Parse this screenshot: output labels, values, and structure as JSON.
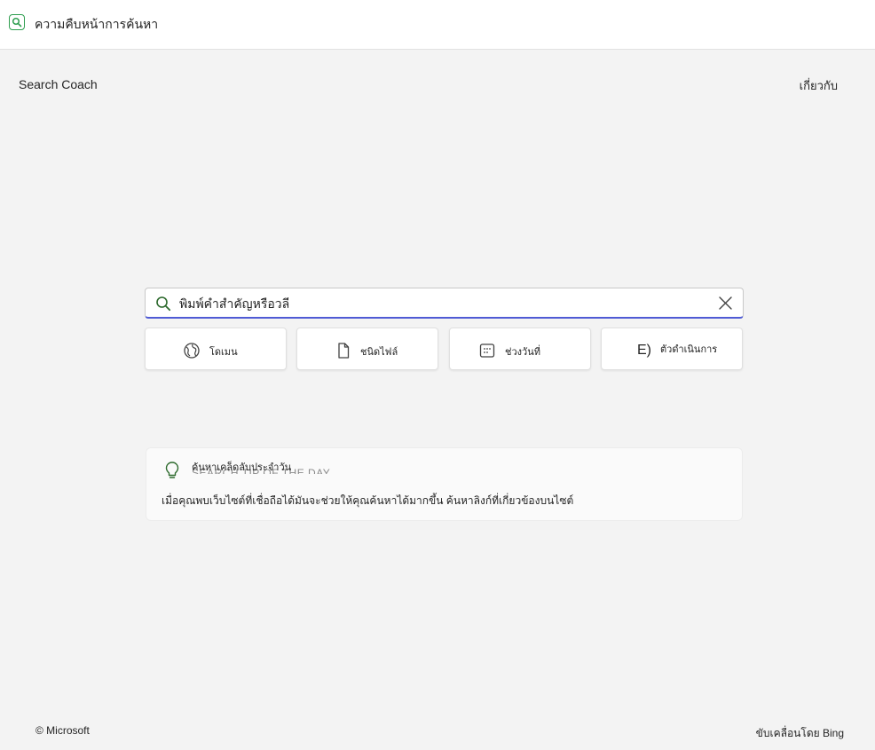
{
  "app": {
    "title": "ความคืบหน้าการค้นหา",
    "icon": "search-icon",
    "accent": "#2e9e4f"
  },
  "header": {
    "brand": "Search Coach",
    "about_label": "เกี่ยวกับ"
  },
  "search": {
    "placeholder": "พิมพ์คำสำคัญหรือวลี",
    "value": "",
    "focus_color": "#4f5bd5"
  },
  "filters": [
    {
      "icon": "globe-icon",
      "label": "โดเมน"
    },
    {
      "icon": "document-icon",
      "label": "ชนิดไฟล์"
    },
    {
      "icon": "calendar-icon",
      "label": "ช่วงวันที่"
    },
    {
      "icon": "operator-icon",
      "icon_text": "E)",
      "label": "ตัวดำเนินการ"
    }
  ],
  "tip": {
    "icon": "lightbulb-icon",
    "heading": "ค้นหาเคล็ดลับประจำวัน",
    "ghost_heading": "SEARCH TIP OF THE DAY",
    "text": "เมื่อคุณพบเว็บไซต์ที่เชื่อถือได้มันจะช่วยให้คุณค้นหาได้มากขึ้น ค้นหาลิงก์ที่เกี่ยวข้องบนไซต์"
  },
  "footer": {
    "copyright": "© Microsoft",
    "powered_by": "ขับเคลื่อนโดย Bing"
  }
}
